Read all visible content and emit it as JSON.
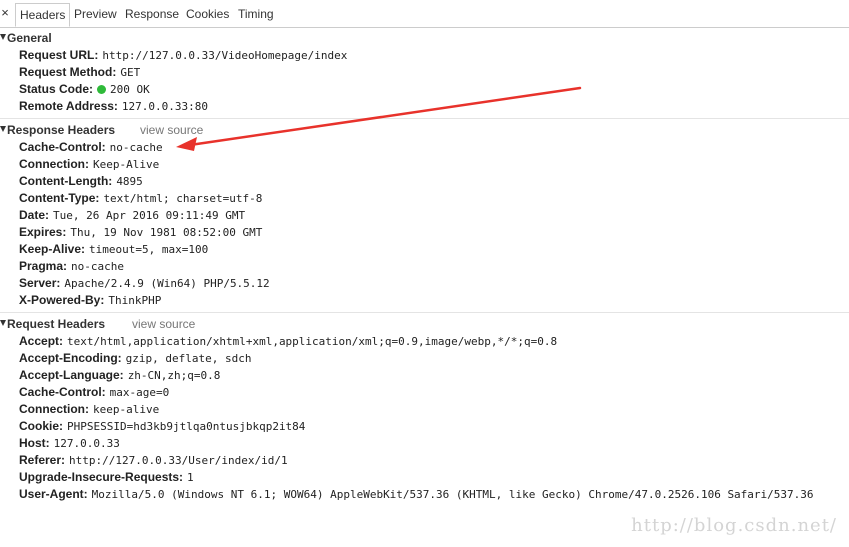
{
  "tabs": {
    "close": "×",
    "items": [
      {
        "label": "Headers",
        "active": true
      },
      {
        "label": "Preview",
        "active": false
      },
      {
        "label": "Response",
        "active": false
      },
      {
        "label": "Cookies",
        "active": false
      },
      {
        "label": "Timing",
        "active": false
      }
    ]
  },
  "general": {
    "title": "General",
    "request_url": {
      "name": "Request URL:",
      "value": "http://127.0.0.33/VideoHomepage/index"
    },
    "request_method": {
      "name": "Request Method:",
      "value": "GET"
    },
    "status_code": {
      "name": "Status Code:",
      "value": "200 OK",
      "dot_color": "#2fba3a"
    },
    "remote_address": {
      "name": "Remote Address:",
      "value": "127.0.0.33:80"
    }
  },
  "response_headers": {
    "title": "Response Headers",
    "view_source": "view source",
    "rows": [
      {
        "name": "Cache-Control:",
        "value": "no-cache"
      },
      {
        "name": "Connection:",
        "value": "Keep-Alive"
      },
      {
        "name": "Content-Length:",
        "value": "4895"
      },
      {
        "name": "Content-Type:",
        "value": "text/html; charset=utf-8"
      },
      {
        "name": "Date:",
        "value": "Tue, 26 Apr 2016 09:11:49 GMT"
      },
      {
        "name": "Expires:",
        "value": "Thu, 19 Nov 1981 08:52:00 GMT"
      },
      {
        "name": "Keep-Alive:",
        "value": "timeout=5, max=100"
      },
      {
        "name": "Pragma:",
        "value": "no-cache"
      },
      {
        "name": "Server:",
        "value": "Apache/2.4.9 (Win64) PHP/5.5.12"
      },
      {
        "name": "X-Powered-By:",
        "value": "ThinkPHP"
      }
    ]
  },
  "request_headers": {
    "title": "Request Headers",
    "view_source": "view source",
    "rows": [
      {
        "name": "Accept:",
        "value": "text/html,application/xhtml+xml,application/xml;q=0.9,image/webp,*/*;q=0.8"
      },
      {
        "name": "Accept-Encoding:",
        "value": "gzip, deflate, sdch"
      },
      {
        "name": "Accept-Language:",
        "value": "zh-CN,zh;q=0.8"
      },
      {
        "name": "Cache-Control:",
        "value": "max-age=0"
      },
      {
        "name": "Connection:",
        "value": "keep-alive"
      },
      {
        "name": "Cookie:",
        "value": "PHPSESSID=hd3kb9jtlqa0ntusjbkqp2it84"
      },
      {
        "name": "Host:",
        "value": "127.0.0.33"
      },
      {
        "name": "Referer:",
        "value": "http://127.0.0.33/User/index/id/1"
      },
      {
        "name": "Upgrade-Insecure-Requests:",
        "value": "1"
      },
      {
        "name": "User-Agent:",
        "value": "Mozilla/5.0 (Windows NT 6.1; WOW64) AppleWebKit/537.36 (KHTML, like Gecko) Chrome/47.0.2526.106 Safari/537.36"
      }
    ]
  },
  "annotation": {
    "arrow_color": "#e8322b",
    "icon": "red-arrow"
  },
  "watermark": "http://blog.csdn.net/"
}
